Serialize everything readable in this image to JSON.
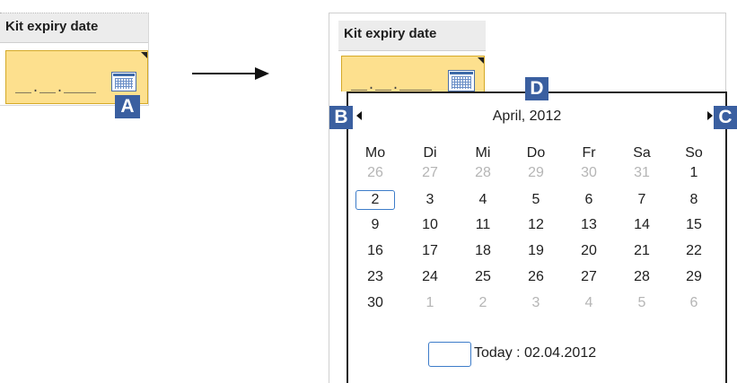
{
  "before": {
    "field_label": "Kit expiry date",
    "date_mask": "__.__.____",
    "badge": "A"
  },
  "after": {
    "field_label": "Kit expiry date",
    "date_mask": "__.__.____",
    "calendar": {
      "month_title": "April, 2012",
      "weekdays": [
        "Mo",
        "Di",
        "Mi",
        "Do",
        "Fr",
        "Sa",
        "So"
      ],
      "weeks": [
        [
          "26",
          "27",
          "28",
          "29",
          "30",
          "31",
          "1"
        ],
        [
          "2",
          "3",
          "4",
          "5",
          "6",
          "7",
          "8"
        ],
        [
          "9",
          "10",
          "11",
          "12",
          "13",
          "14",
          "15"
        ],
        [
          "16",
          "17",
          "18",
          "19",
          "20",
          "21",
          "22"
        ],
        [
          "23",
          "24",
          "25",
          "26",
          "27",
          "28",
          "29"
        ],
        [
          "30",
          "1",
          "2",
          "3",
          "4",
          "5",
          "6"
        ]
      ],
      "other_month_flags": [
        [
          true,
          true,
          true,
          true,
          true,
          true,
          false
        ],
        [
          false,
          false,
          false,
          false,
          false,
          false,
          false
        ],
        [
          false,
          false,
          false,
          false,
          false,
          false,
          false
        ],
        [
          false,
          false,
          false,
          false,
          false,
          false,
          false
        ],
        [
          false,
          false,
          false,
          false,
          false,
          false,
          false
        ],
        [
          false,
          true,
          true,
          true,
          true,
          true,
          true
        ]
      ],
      "selected_day": "2",
      "today_label": "Today : 02.04.2012"
    },
    "badges": {
      "prev": "B",
      "title": "D",
      "next": "C"
    }
  },
  "icons": {
    "calendar_button": "calendar-icon",
    "prev_month": "triangle-left-icon",
    "next_month": "triangle-right-icon",
    "transition": "arrow-right-icon"
  },
  "colors": {
    "field_bg": "#fde08e",
    "badge_bg": "#3a5fa0",
    "selection_border": "#3d7cc9",
    "other_month_text": "#b5b5b5"
  }
}
